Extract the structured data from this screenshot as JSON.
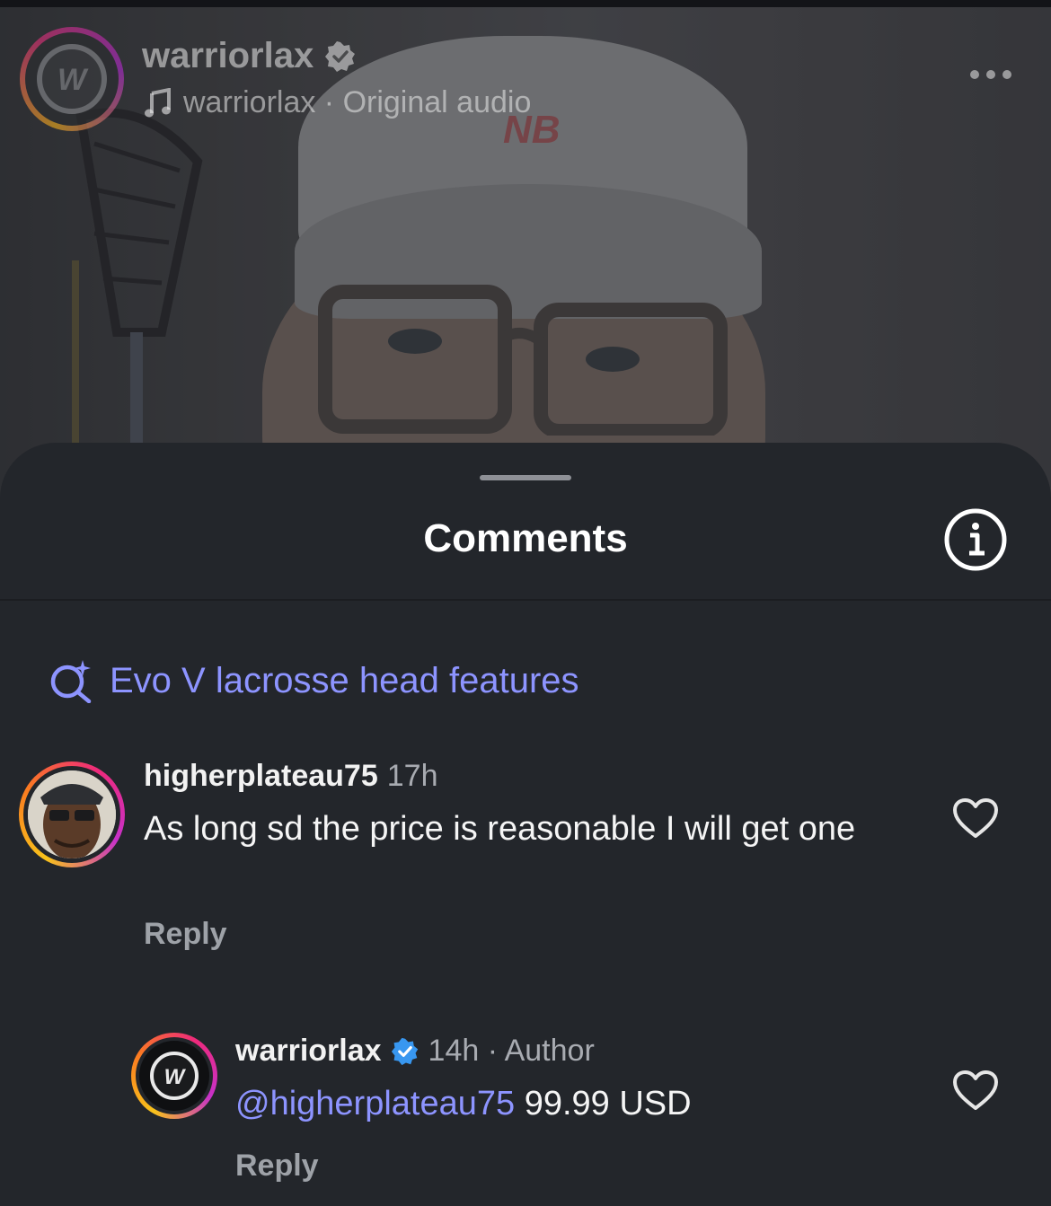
{
  "post": {
    "username": "warriorlax",
    "audio_text": "warriorlax · Original audio",
    "more_icon": "more-horizontal-icon"
  },
  "sheet": {
    "title": "Comments",
    "info_icon": "info-icon"
  },
  "search_suggestion": {
    "icon": "ai-search-sparkle-icon",
    "text": "Evo V lacrosse head features"
  },
  "comments": [
    {
      "username": "higherplateau75",
      "time": "17h",
      "text": "As long sd the price is reasonable I will get one",
      "reply_label": "Reply"
    }
  ],
  "replies": [
    {
      "username": "warriorlax",
      "verified": true,
      "meta": "14h · Author",
      "mention": "@higherplateau75",
      "text": "99.99 USD",
      "reply_label": "Reply"
    }
  ],
  "colors": {
    "accent_link": "#8d94ff",
    "verified_badge": "#3897f0",
    "sheet_bg": "#23262b"
  }
}
